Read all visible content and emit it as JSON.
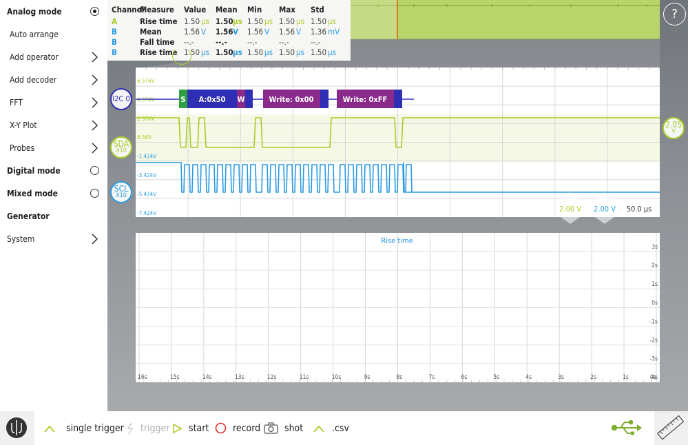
{
  "menu": {
    "items": [
      {
        "label": "Analog mode",
        "kind": "top",
        "control": "radio-on"
      },
      {
        "label": "Auto arrange",
        "kind": "sub",
        "control": "none"
      },
      {
        "label": "Add operator",
        "kind": "sub",
        "control": "chevron"
      },
      {
        "label": "Add decoder",
        "kind": "sub",
        "control": "chevron"
      },
      {
        "label": "FFT",
        "kind": "sub",
        "control": "chevron"
      },
      {
        "label": "X-Y Plot",
        "kind": "sub",
        "control": "chevron"
      },
      {
        "label": "Probes",
        "kind": "sub",
        "control": "chevron"
      },
      {
        "label": "Digital mode",
        "kind": "top",
        "control": "radio-off"
      },
      {
        "label": "Mixed mode",
        "kind": "top",
        "control": "radio-off"
      },
      {
        "label": "Generator",
        "kind": "top",
        "control": "none"
      },
      {
        "label": "System",
        "kind": "top-light",
        "control": "chevron"
      }
    ]
  },
  "measurements": {
    "headers": [
      "Channel",
      "Measure",
      "Value",
      "Mean",
      "Min",
      "Max",
      "Std"
    ],
    "rows": [
      {
        "channel": "A",
        "measure": "Rise time",
        "value": "1.50",
        "value_unit": "µs",
        "mean": "1.50",
        "mean_unit": "µs",
        "min": "1.50",
        "min_unit": "µs",
        "max": "1.50",
        "max_unit": "µs",
        "std": "1.50",
        "std_unit": "µs"
      },
      {
        "channel": "B",
        "measure": "Mean",
        "value": "1.56",
        "value_unit": "V",
        "mean": "1.56",
        "mean_unit": "V",
        "min": "1.56",
        "min_unit": "V",
        "max": "1.56",
        "max_unit": "V",
        "std": "1.36",
        "std_unit": "mV"
      },
      {
        "channel": "B",
        "measure": "Fall time",
        "value": "--.-",
        "value_unit": "",
        "mean": "--.-",
        "mean_unit": "",
        "min": "--.-",
        "min_unit": "",
        "max": "--.-",
        "max_unit": "",
        "std": "--.-",
        "std_unit": ""
      },
      {
        "channel": "B",
        "measure": "Rise time",
        "value": "1.50",
        "value_unit": "µs",
        "mean": "1.50",
        "mean_unit": "µs",
        "min": "1.50",
        "min_unit": "µs",
        "max": "1.50",
        "max_unit": "µs",
        "std": "1.50",
        "std_unit": "µs"
      }
    ]
  },
  "help_label": "?",
  "waveform": {
    "y_labels": [
      "6.576V",
      "4.576V",
      "2.576V",
      "0.56V",
      "-1.424V",
      "-3.424V",
      "-5.424V",
      "-7.424V"
    ],
    "i2c_label": "I2C 0",
    "sda_label": "SDA",
    "sda_probe": "X10",
    "scl_label": "SCL",
    "scl_probe": "X10",
    "trigger_level": "2.05",
    "trigger_unit": "V",
    "decode": [
      {
        "text": "S",
        "color": "#2ea043"
      },
      {
        "text": "A:0x50",
        "color": "#2f2fb5"
      },
      {
        "text": "W",
        "color": "#8a2a8a"
      },
      {
        "text": "Write: 0x00",
        "color": "#8a2a8a"
      },
      {
        "text": "Write: 0xFF",
        "color": "#8a2a8a"
      }
    ],
    "scale_a": "2.00 V",
    "scale_b": "2.00 V",
    "timebase": "50.0 µs"
  },
  "colors": {
    "channel_a": "#a9cc2b",
    "channel_b": "#2a9ae0",
    "decoder": "#2f2fb5"
  },
  "chart_data": {
    "type": "line",
    "title": "Rise time",
    "x_tick_labels": [
      "16s",
      "15s",
      "14s",
      "13s",
      "12s",
      "11s",
      "10s",
      "9s",
      "8s",
      "7s",
      "6s",
      "5s",
      "4s",
      "3s",
      "2s",
      "1s",
      "0s"
    ],
    "y_tick_labels": [
      "3s",
      "2s",
      "1s",
      "0s",
      "-1s",
      "-2s",
      "-3s",
      "-4s"
    ],
    "series": []
  },
  "toolbar": {
    "single_trigger": "single trigger",
    "trigger": "trigger",
    "start": "start",
    "record": "record",
    "shot": "shot",
    "csv": ".csv"
  }
}
